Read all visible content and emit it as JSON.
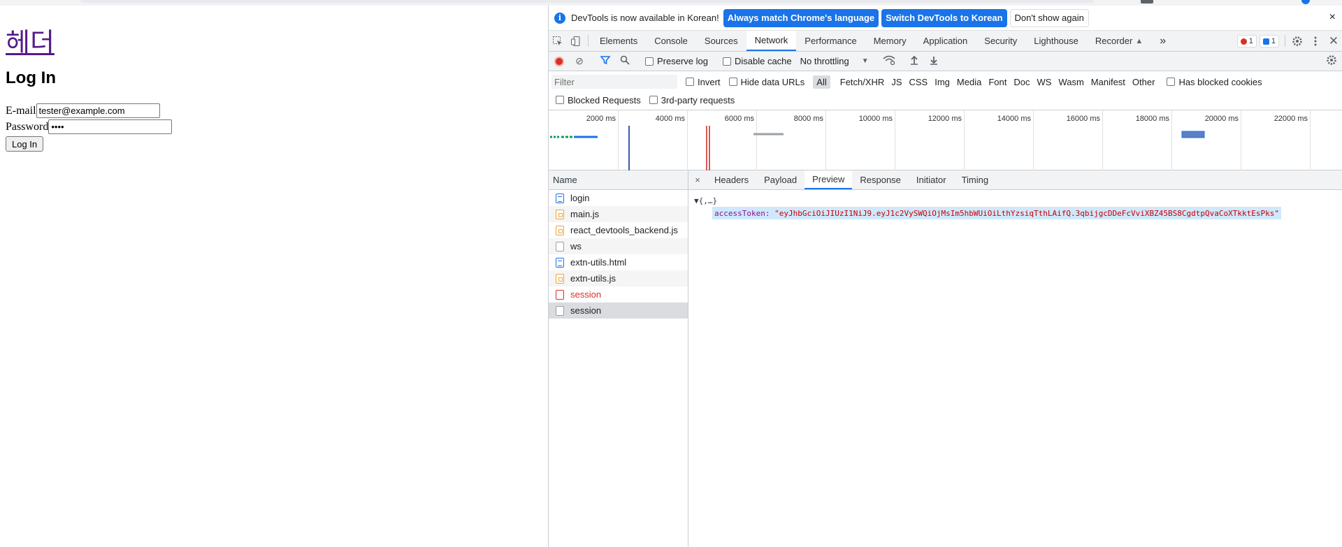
{
  "page": {
    "header_link": "헤더",
    "heading": "Log In",
    "email_label": "E-mail",
    "email_value": "tester@example.com",
    "password_label": "Password",
    "password_value": "••••",
    "login_button": "Log In"
  },
  "devtools": {
    "infobar": {
      "message": "DevTools is now available in Korean!",
      "btn_match": "Always match Chrome's language",
      "btn_switch": "Switch DevTools to Korean",
      "btn_dismiss": "Don't show again",
      "close": "×"
    },
    "tabs": [
      "Elements",
      "Console",
      "Sources",
      "Network",
      "Performance",
      "Memory",
      "Application",
      "Security",
      "Lighthouse",
      "Recorder"
    ],
    "more_tabs": "»",
    "error_count": "1",
    "message_count": "1",
    "network_toolbar": {
      "preserve_log": "Preserve log",
      "disable_cache": "Disable cache",
      "throttling": "No throttling"
    },
    "filter": {
      "placeholder": "Filter",
      "invert": "Invert",
      "hide_data_urls": "Hide data URLs",
      "types": [
        "All",
        "Fetch/XHR",
        "JS",
        "CSS",
        "Img",
        "Media",
        "Font",
        "Doc",
        "WS",
        "Wasm",
        "Manifest",
        "Other"
      ],
      "has_blocked_cookies": "Has blocked cookies",
      "blocked_requests": "Blocked Requests",
      "third_party": "3rd-party requests"
    },
    "timeline": {
      "ticks": [
        "2000 ms",
        "4000 ms",
        "6000 ms",
        "8000 ms",
        "10000 ms",
        "12000 ms",
        "14000 ms",
        "16000 ms",
        "18000 ms",
        "20000 ms",
        "22000 ms"
      ]
    },
    "requests": {
      "header": "Name",
      "items": [
        {
          "name": "login",
          "icon": "doc"
        },
        {
          "name": "main.js",
          "icon": "js"
        },
        {
          "name": "react_devtools_backend.js",
          "icon": "js"
        },
        {
          "name": "ws",
          "icon": "blank"
        },
        {
          "name": "extn-utils.html",
          "icon": "doc"
        },
        {
          "name": "extn-utils.js",
          "icon": "js"
        },
        {
          "name": "session",
          "icon": "red"
        },
        {
          "name": "session",
          "icon": "blank"
        }
      ]
    },
    "detail": {
      "close": "×",
      "tabs": [
        "Headers",
        "Payload",
        "Preview",
        "Response",
        "Initiator",
        "Timing"
      ],
      "preview_root": "▼{,…}",
      "token_key": "accessToken:",
      "token_value": "\"eyJhbGciOiJIUzI1NiJ9.eyJ1c2VySWQiOjMsIm5hbWUiOiLthYzsiqTthLAifQ.3qbijgcDDeFcVviXBZ45BS8CgdtpQvaCoXTkktEsPks\""
    },
    "colors": {
      "accent": "#1a73e8",
      "record": "#d93025",
      "error_text": "#d93025",
      "token_key": "#881391",
      "token_value": "#c80000",
      "selection": "#cfe8fc"
    }
  }
}
